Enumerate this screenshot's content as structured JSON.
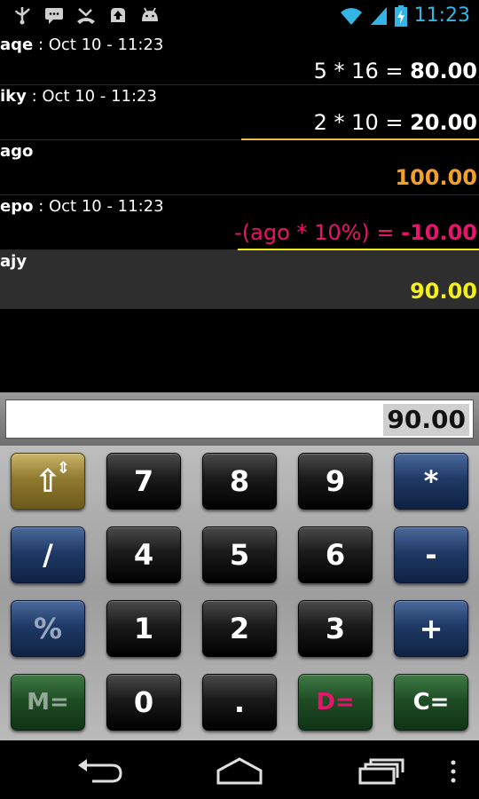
{
  "status_bar": {
    "time": "11:23",
    "left_icons": [
      "usb-debug-icon",
      "chat-icon",
      "missed-call-icon",
      "upload-icon",
      "android-icon"
    ],
    "right_icons": [
      "wifi-icon",
      "signal-icon",
      "battery-charging-icon"
    ],
    "accent_color": "#33b5e5"
  },
  "tape": {
    "entries": [
      {
        "name": "aqe",
        "timestamp": " : Oct 10 - 11:23",
        "expression": "5 * 16 =  ",
        "result": "80.00",
        "result_color": "#ffffff"
      },
      {
        "name": "iky",
        "timestamp": " : Oct 10 - 11:23",
        "expression": "2 * 10 =  ",
        "result": "20.00",
        "result_color": "#ffffff"
      },
      {
        "name": "ago",
        "timestamp": "",
        "expression": "",
        "result": "100.00",
        "result_color": "#f2a02a"
      },
      {
        "name": "epo",
        "timestamp": " : Oct 10 - 11:23",
        "expression": "-(ago * 10%) =  ",
        "result": "-10.00",
        "result_color": "#e8146c",
        "expression_color": "#e8146c"
      },
      {
        "name": "ajy",
        "timestamp": "",
        "expression": "",
        "result": "90.00",
        "result_color": "#f5ef1a"
      }
    ]
  },
  "display": {
    "value": "90.00"
  },
  "keypad": {
    "keys": [
      {
        "label": "⇧",
        "name": "shift-key",
        "style": "gold"
      },
      {
        "label": "7",
        "name": "key-7",
        "style": "black"
      },
      {
        "label": "8",
        "name": "key-8",
        "style": "black"
      },
      {
        "label": "9",
        "name": "key-9",
        "style": "black"
      },
      {
        "label": "*",
        "name": "key-multiply",
        "style": "blue"
      },
      {
        "label": "/",
        "name": "key-divide",
        "style": "blue"
      },
      {
        "label": "4",
        "name": "key-4",
        "style": "black"
      },
      {
        "label": "5",
        "name": "key-5",
        "style": "black"
      },
      {
        "label": "6",
        "name": "key-6",
        "style": "black"
      },
      {
        "label": "-",
        "name": "key-minus",
        "style": "blue"
      },
      {
        "label": "%",
        "name": "key-percent",
        "style": "blue"
      },
      {
        "label": "1",
        "name": "key-1",
        "style": "black"
      },
      {
        "label": "2",
        "name": "key-2",
        "style": "black"
      },
      {
        "label": "3",
        "name": "key-3",
        "style": "black"
      },
      {
        "label": "+",
        "name": "key-plus",
        "style": "blue"
      },
      {
        "label": "M=",
        "name": "key-memory",
        "style": "green"
      },
      {
        "label": "0",
        "name": "key-0",
        "style": "black"
      },
      {
        "label": ".",
        "name": "key-decimal",
        "style": "black"
      },
      {
        "label": "D=",
        "name": "key-d-equals",
        "style": "green",
        "text_color": "#e8146c"
      },
      {
        "label": "C=",
        "name": "key-c-equals",
        "style": "green"
      }
    ],
    "shift_secondary": "⇕"
  },
  "nav_bar": {
    "icons": [
      "back-icon",
      "home-icon",
      "recent-apps-icon",
      "menu-icon"
    ]
  }
}
